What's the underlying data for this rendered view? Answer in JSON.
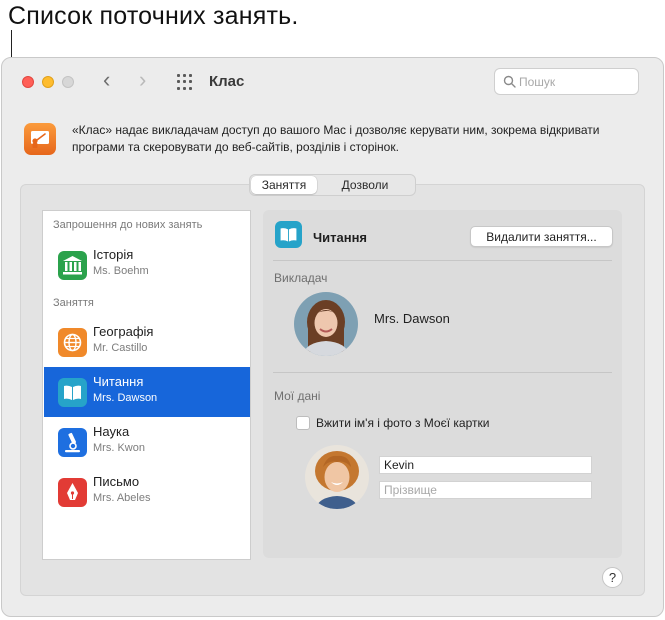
{
  "callout": {
    "text": "Список поточних занять."
  },
  "window": {
    "title": "Клас",
    "search_placeholder": "Пошук",
    "description": "«Клас» надає викладачам доступ до вашого Mac і дозволяє керувати ним, зокрема відкривати програми та скеровувати до веб-сайтів, розділів і сторінок."
  },
  "tabs": [
    {
      "label": "Заняття",
      "active": true
    },
    {
      "label": "Дозволи",
      "active": false
    }
  ],
  "class_list": {
    "invitations_header": "Запрошення до нових занять",
    "invitations": [
      {
        "name": "Історія",
        "teacher": "Ms. Boehm",
        "icon": "history-columns-icon",
        "color": "#2ba24c"
      }
    ],
    "classes_header": "Заняття",
    "classes": [
      {
        "name": "Географія",
        "teacher": "Mr. Castillo",
        "icon": "globe-icon",
        "color": "#f0892a",
        "selected": false
      },
      {
        "name": "Читання",
        "teacher": "Mrs. Dawson",
        "icon": "book-icon",
        "color": "#26a3c9",
        "selected": true
      },
      {
        "name": "Наука",
        "teacher": "Mrs. Kwon",
        "icon": "microscope-icon",
        "color": "#1e6fe0",
        "selected": false
      },
      {
        "name": "Письмо",
        "teacher": "Mrs. Abeles",
        "icon": "pen-nib-icon",
        "color": "#e23b35",
        "selected": false
      }
    ]
  },
  "detail": {
    "title": "Читання",
    "delete_button": "Видалити заняття...",
    "teacher_section": "Викладач",
    "teacher_name": "Mrs. Dawson",
    "my_info_section": "Мої дані",
    "use_card_checkbox": "Вжити ім'я і фото з Моєї картки",
    "use_card_checked": false,
    "first_name_value": "Kevin",
    "last_name_placeholder": "Прізвище"
  },
  "help_button": "?"
}
